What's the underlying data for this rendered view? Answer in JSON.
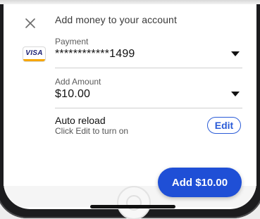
{
  "sheet": {
    "title": "Add money to your account"
  },
  "payment": {
    "label": "Payment",
    "value": "************1499",
    "card_brand": "VISA"
  },
  "amount": {
    "label": "Add Amount",
    "value": "$10.00"
  },
  "auto_reload": {
    "title": "Auto reload",
    "subtitle": "Click Edit to turn on",
    "edit_label": "Edit"
  },
  "primary_action": {
    "label": "Add $10.00"
  },
  "icons": {
    "close": "close-icon",
    "chevron": "chevron-down-icon",
    "card": "visa-card-icon"
  },
  "colors": {
    "accent": "#1f4fd6",
    "text": "#111111",
    "muted": "#5c5c5c"
  }
}
